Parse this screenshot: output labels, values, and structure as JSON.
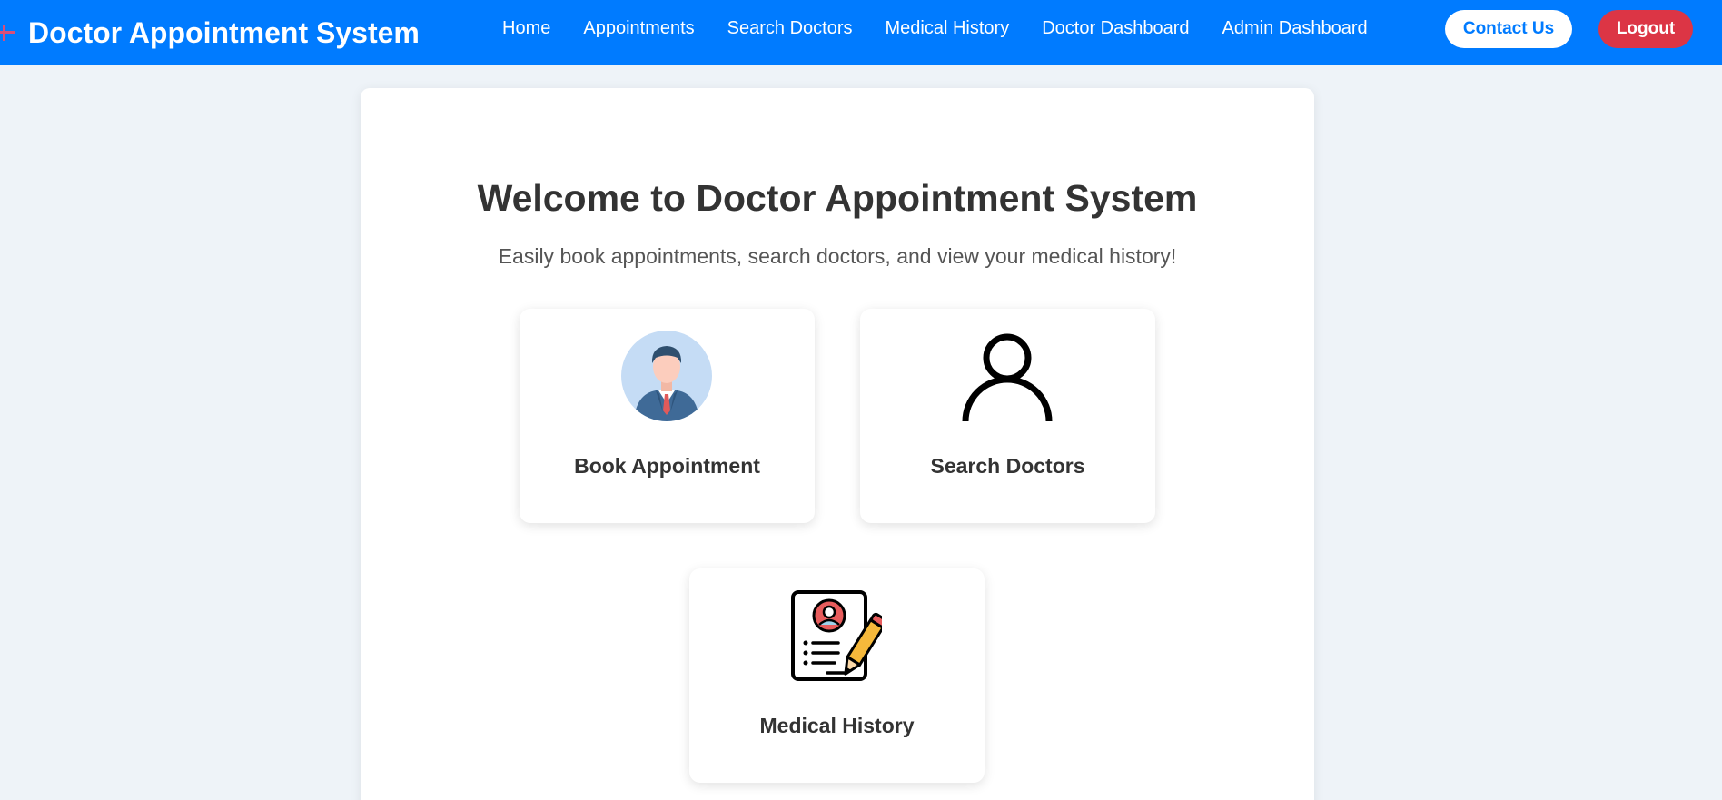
{
  "header": {
    "brand": "Doctor Appointment System",
    "nav": [
      {
        "label": "Home"
      },
      {
        "label": "Appointments"
      },
      {
        "label": "Search Doctors"
      },
      {
        "label": "Medical History"
      },
      {
        "label": "Doctor Dashboard"
      },
      {
        "label": "Admin Dashboard"
      }
    ],
    "contact_label": "Contact Us",
    "logout_label": "Logout"
  },
  "main": {
    "title": "Welcome to Doctor Appointment System",
    "subtitle": "Easily book appointments, search doctors, and view your medical history!",
    "cards": [
      {
        "label": "Book Appointment",
        "icon": "doctor-avatar-icon"
      },
      {
        "label": "Search Doctors",
        "icon": "user-outline-icon"
      },
      {
        "label": "Medical History",
        "icon": "medical-record-icon"
      }
    ]
  },
  "colors": {
    "primary": "#007bff",
    "danger": "#dc3545",
    "background": "#eef3f8",
    "card": "#ffffff",
    "text": "#333333"
  }
}
